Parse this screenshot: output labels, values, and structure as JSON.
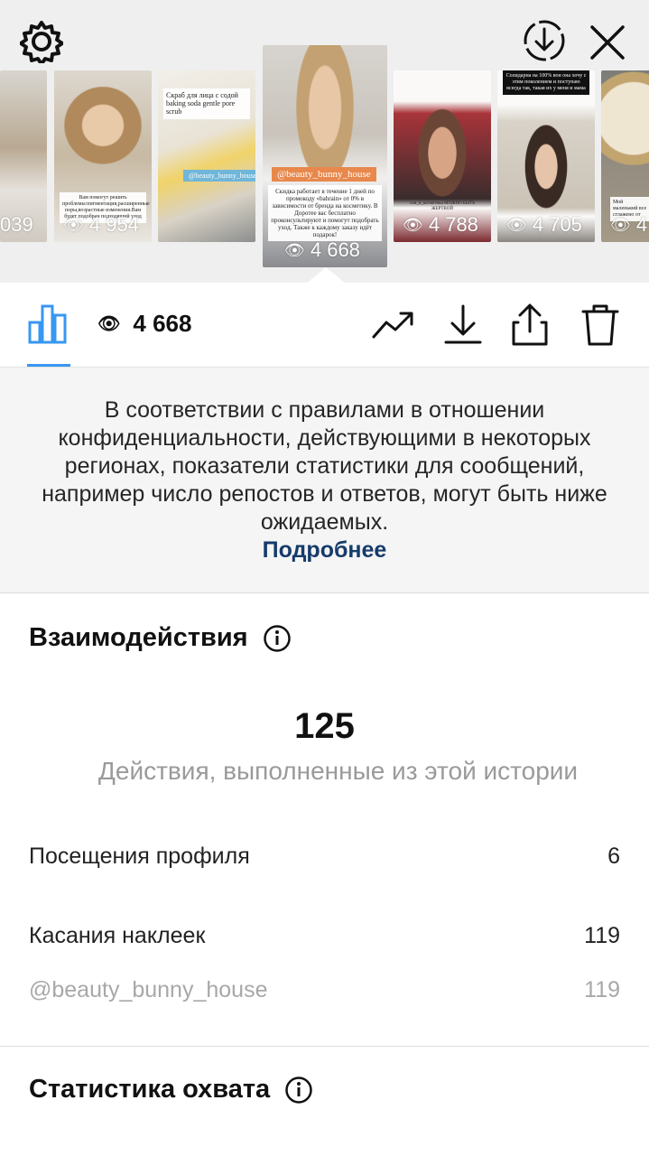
{
  "top_bar": {
    "settings_icon": "gear-icon",
    "save_icon": "download-circle-icon",
    "close_icon": "close-icon"
  },
  "stories": [
    {
      "views": "039",
      "caption": ""
    },
    {
      "views": "4 954",
      "caption": "Вам помогут решить проблемы:пигментация,расширенные поры,возрастные изменения.Вам будет подобран подходящий уход"
    },
    {
      "views": "",
      "caption": "Скраб для лица с содой baking soda gentle pore scrub",
      "tag": "@beauty_bunny_house"
    },
    {
      "views": "4 668",
      "tag": "@beauty_bunny_house",
      "caption": "Скидка работает в течение 1 дней по промокоду «bahrain» от 0% в зависимости от бренда на косметику. В Доротее вас бесплатно проконсультируют и помогут подобрать уход. Также к каждому заказу идёт подарок!"
    },
    {
      "views": "4 788",
      "caption": "сон_и_косметика МОЖНО БЫТЬ ЖЕРТВОЙ"
    },
    {
      "views": "4 705",
      "caption": "Солидарна на 100% вон она хочу с этим поколением и поступаю всегда так, такая их у меня и мама"
    },
    {
      "views": "4",
      "caption": "Мой маленький все сглажено от"
    }
  ],
  "toolbar": {
    "views_count": "4 668",
    "chart_icon": "bar-chart-icon",
    "trend_icon": "trend-icon",
    "download_icon": "download-icon",
    "share_icon": "share-icon",
    "delete_icon": "trash-icon"
  },
  "notice": {
    "text": "В соответствии с правилами в отношении конфиденциальности, действующими в некоторых регионах, показатели статистики для сообщений, например число репостов и ответов, могут быть ниже ожидаемых.",
    "link": "Подробнее"
  },
  "interactions": {
    "title": "Взаимодействия",
    "total": "125",
    "total_caption": "Действия, выполненные из этой истории",
    "rows": [
      {
        "label": "Посещения профиля",
        "value": "6"
      },
      {
        "label": "Касания наклеек",
        "value": "119"
      },
      {
        "label": "@beauty_bunny_house",
        "value": "119"
      }
    ]
  },
  "reach": {
    "title": "Статистика охвата"
  }
}
